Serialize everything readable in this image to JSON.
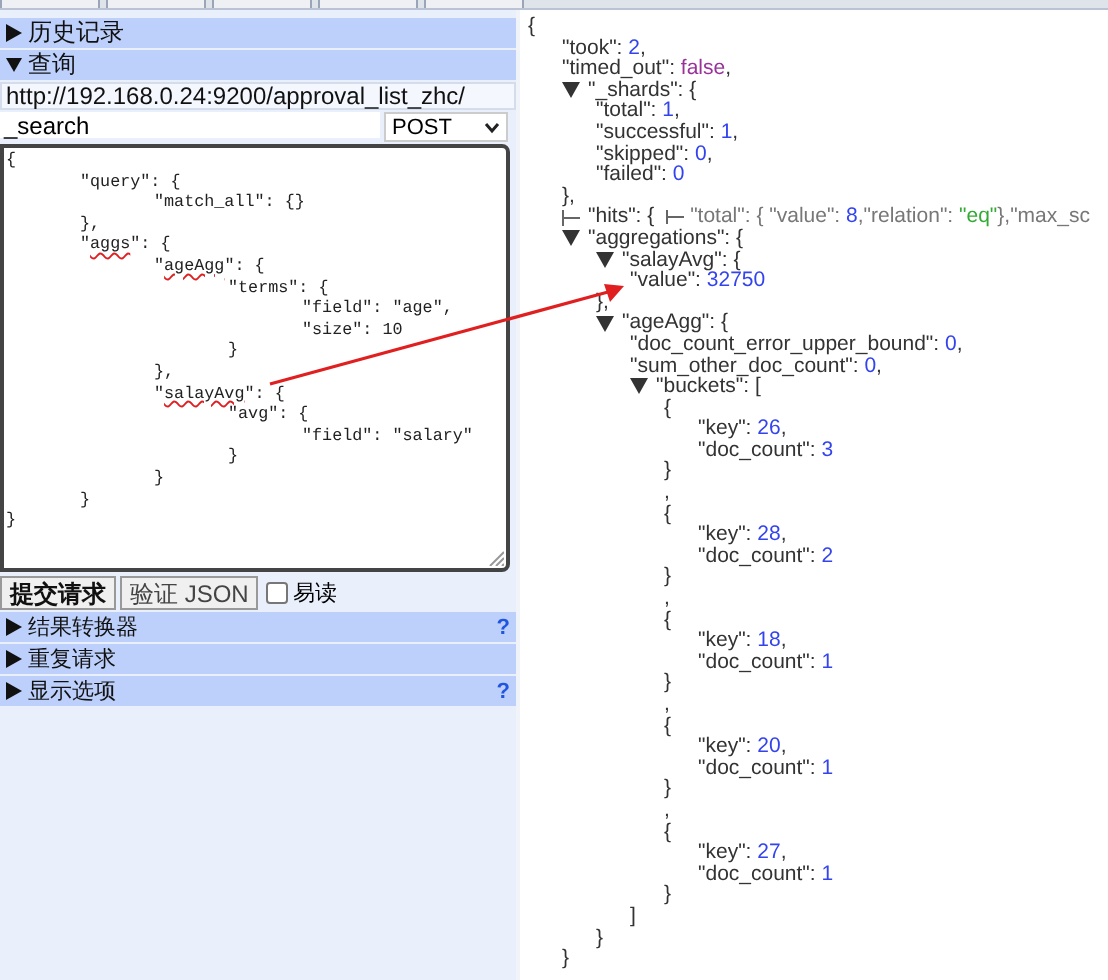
{
  "sections_top": [
    {
      "label": "历史记录",
      "expanded": false
    },
    {
      "label": "查询",
      "expanded": true
    }
  ],
  "query": {
    "url": "http://192.168.0.24:9200/approval_list_zhc/",
    "path": "_search",
    "method": "POST",
    "body": [
      {
        "segs": [
          {
            "t": "{"
          }
        ]
      },
      {
        "segs": [
          {
            "t": "\t\"query\": {"
          }
        ]
      },
      {
        "segs": [
          {
            "t": "\t\t\"match_all\": {}"
          }
        ]
      },
      {
        "segs": [
          {
            "t": "\t},"
          }
        ]
      },
      {
        "segs": [
          {
            "t": "\t\""
          },
          {
            "t": "aggs",
            "misspelled": true
          },
          {
            "t": "\": {"
          }
        ]
      },
      {
        "segs": [
          {
            "t": "\t\t\""
          },
          {
            "t": "ageAgg",
            "misspelled": true
          },
          {
            "t": "\": {"
          }
        ]
      },
      {
        "segs": [
          {
            "t": "\t\t\t\"terms\": {"
          }
        ]
      },
      {
        "segs": [
          {
            "t": "\t\t\t\t\"field\": \"age\","
          }
        ]
      },
      {
        "segs": [
          {
            "t": "\t\t\t\t\"size\": 10"
          }
        ]
      },
      {
        "segs": [
          {
            "t": "\t\t\t}"
          }
        ]
      },
      {
        "segs": [
          {
            "t": "\t\t},"
          }
        ]
      },
      {
        "segs": [
          {
            "t": "\t\t\""
          },
          {
            "t": "salayAvg",
            "misspelled": true
          },
          {
            "t": "\": {"
          }
        ]
      },
      {
        "segs": [
          {
            "t": "\t\t\t\"avg\": {"
          }
        ]
      },
      {
        "segs": [
          {
            "t": "\t\t\t\t\"field\": \"salary\""
          }
        ]
      },
      {
        "segs": [
          {
            "t": "\t\t\t}"
          }
        ]
      },
      {
        "segs": [
          {
            "t": "\t\t}"
          }
        ]
      },
      {
        "segs": [
          {
            "t": "\t}"
          }
        ]
      },
      {
        "segs": [
          {
            "t": "}"
          }
        ]
      }
    ]
  },
  "actions": {
    "submit": "提交请求",
    "validate": "验证 JSON",
    "pretty": {
      "label": "易读",
      "checked": false
    }
  },
  "sections_bottom": [
    {
      "label": "结果转换器",
      "expanded": false,
      "help": "?"
    },
    {
      "label": "重复请求",
      "expanded": false
    },
    {
      "label": "显示选项",
      "expanded": false,
      "help": "?"
    }
  ],
  "response": [
    {
      "segs": [
        {
          "text": "{",
          "kind": "punct"
        }
      ],
      "children": [
        {
          "segs": [
            {
              "text": "\"took\": ",
              "kind": "key"
            },
            {
              "text": "2",
              "kind": "number"
            },
            {
              "text": ",",
              "kind": "punct"
            }
          ]
        },
        {
          "segs": [
            {
              "text": "\"timed_out\": ",
              "kind": "key"
            },
            {
              "text": "false",
              "kind": "bool"
            },
            {
              "text": ",",
              "kind": "punct"
            }
          ]
        },
        {
          "expanded": true,
          "segs": [
            {
              "text": "\"_shards\": {",
              "kind": "key"
            }
          ],
          "children": [
            {
              "segs": [
                {
                  "text": "\"total\": ",
                  "kind": "key"
                },
                {
                  "text": "1",
                  "kind": "number"
                },
                {
                  "text": ",",
                  "kind": "punct"
                }
              ]
            },
            {
              "segs": [
                {
                  "text": "\"successful\": ",
                  "kind": "key"
                },
                {
                  "text": "1",
                  "kind": "number"
                },
                {
                  "text": ",",
                  "kind": "punct"
                }
              ]
            },
            {
              "segs": [
                {
                  "text": "\"skipped\": ",
                  "kind": "key"
                },
                {
                  "text": "0",
                  "kind": "number"
                },
                {
                  "text": ",",
                  "kind": "punct"
                }
              ]
            },
            {
              "segs": [
                {
                  "text": "\"failed\": ",
                  "kind": "key"
                },
                {
                  "text": "0",
                  "kind": "number"
                }
              ]
            }
          ]
        },
        {
          "segs": [
            {
              "text": "},",
              "kind": "punct"
            }
          ]
        },
        {
          "expanded": false,
          "segs": [
            {
              "text": "\"hits\": { ",
              "kind": "key"
            },
            {
              "kind": "fold"
            },
            {
              "text": "\"total\": { \"value\": ",
              "kind": "summary"
            },
            {
              "text": "8",
              "kind": "number"
            },
            {
              "text": ",\"relation\": ",
              "kind": "summary"
            },
            {
              "text": "\"eq\"",
              "kind": "string"
            },
            {
              "text": "},\"max_sc",
              "kind": "summary"
            }
          ]
        },
        {
          "expanded": true,
          "segs": [
            {
              "text": "\"aggregations\": {",
              "kind": "key"
            }
          ],
          "children": [
            {
              "expanded": true,
              "segs": [
                {
                  "text": "\"salayAvg\": {",
                  "kind": "key"
                }
              ],
              "children": [
                {
                  "segs": [
                    {
                      "text": "\"value\": ",
                      "kind": "key"
                    },
                    {
                      "text": "32750",
                      "kind": "number"
                    }
                  ]
                }
              ]
            },
            {
              "segs": [
                {
                  "text": "},",
                  "kind": "punct"
                }
              ]
            },
            {
              "expanded": true,
              "segs": [
                {
                  "text": "\"ageAgg\": {",
                  "kind": "key"
                }
              ],
              "children": [
                {
                  "segs": [
                    {
                      "text": "\"doc_count_error_upper_bound\": ",
                      "kind": "key"
                    },
                    {
                      "text": "0",
                      "kind": "number"
                    },
                    {
                      "text": ",",
                      "kind": "punct"
                    }
                  ]
                },
                {
                  "segs": [
                    {
                      "text": "\"sum_other_doc_count\": ",
                      "kind": "key"
                    },
                    {
                      "text": "0",
                      "kind": "number"
                    },
                    {
                      "text": ",",
                      "kind": "punct"
                    }
                  ]
                },
                {
                  "expanded": true,
                  "segs": [
                    {
                      "text": "\"buckets\": [",
                      "kind": "key"
                    }
                  ],
                  "children": [
                    {
                      "segs": [
                        {
                          "text": "{",
                          "kind": "punct"
                        }
                      ],
                      "children": [
                        {
                          "segs": [
                            {
                              "text": "\"key\": ",
                              "kind": "key"
                            },
                            {
                              "text": "26",
                              "kind": "number"
                            },
                            {
                              "text": ",",
                              "kind": "punct"
                            }
                          ]
                        },
                        {
                          "segs": [
                            {
                              "text": "\"doc_count\": ",
                              "kind": "key"
                            },
                            {
                              "text": "3",
                              "kind": "number"
                            }
                          ]
                        }
                      ]
                    },
                    {
                      "segs": [
                        {
                          "text": "}",
                          "kind": "punct"
                        }
                      ]
                    },
                    {
                      "segs": [
                        {
                          "text": ",",
                          "kind": "punct"
                        }
                      ]
                    },
                    {
                      "segs": [
                        {
                          "text": "{",
                          "kind": "punct"
                        }
                      ],
                      "children": [
                        {
                          "segs": [
                            {
                              "text": "\"key\": ",
                              "kind": "key"
                            },
                            {
                              "text": "28",
                              "kind": "number"
                            },
                            {
                              "text": ",",
                              "kind": "punct"
                            }
                          ]
                        },
                        {
                          "segs": [
                            {
                              "text": "\"doc_count\": ",
                              "kind": "key"
                            },
                            {
                              "text": "2",
                              "kind": "number"
                            }
                          ]
                        }
                      ]
                    },
                    {
                      "segs": [
                        {
                          "text": "}",
                          "kind": "punct"
                        }
                      ]
                    },
                    {
                      "segs": [
                        {
                          "text": ",",
                          "kind": "punct"
                        }
                      ]
                    },
                    {
                      "segs": [
                        {
                          "text": "{",
                          "kind": "punct"
                        }
                      ],
                      "children": [
                        {
                          "segs": [
                            {
                              "text": "\"key\": ",
                              "kind": "key"
                            },
                            {
                              "text": "18",
                              "kind": "number"
                            },
                            {
                              "text": ",",
                              "kind": "punct"
                            }
                          ]
                        },
                        {
                          "segs": [
                            {
                              "text": "\"doc_count\": ",
                              "kind": "key"
                            },
                            {
                              "text": "1",
                              "kind": "number"
                            }
                          ]
                        }
                      ]
                    },
                    {
                      "segs": [
                        {
                          "text": "}",
                          "kind": "punct"
                        }
                      ]
                    },
                    {
                      "segs": [
                        {
                          "text": ",",
                          "kind": "punct"
                        }
                      ]
                    },
                    {
                      "segs": [
                        {
                          "text": "{",
                          "kind": "punct"
                        }
                      ],
                      "children": [
                        {
                          "segs": [
                            {
                              "text": "\"key\": ",
                              "kind": "key"
                            },
                            {
                              "text": "20",
                              "kind": "number"
                            },
                            {
                              "text": ",",
                              "kind": "punct"
                            }
                          ]
                        },
                        {
                          "segs": [
                            {
                              "text": "\"doc_count\": ",
                              "kind": "key"
                            },
                            {
                              "text": "1",
                              "kind": "number"
                            }
                          ]
                        }
                      ]
                    },
                    {
                      "segs": [
                        {
                          "text": "}",
                          "kind": "punct"
                        }
                      ]
                    },
                    {
                      "segs": [
                        {
                          "text": ",",
                          "kind": "punct"
                        }
                      ]
                    },
                    {
                      "segs": [
                        {
                          "text": "{",
                          "kind": "punct"
                        }
                      ],
                      "children": [
                        {
                          "segs": [
                            {
                              "text": "\"key\": ",
                              "kind": "key"
                            },
                            {
                              "text": "27",
                              "kind": "number"
                            },
                            {
                              "text": ",",
                              "kind": "punct"
                            }
                          ]
                        },
                        {
                          "segs": [
                            {
                              "text": "\"doc_count\": ",
                              "kind": "key"
                            },
                            {
                              "text": "1",
                              "kind": "number"
                            }
                          ]
                        }
                      ]
                    },
                    {
                      "segs": [
                        {
                          "text": "}",
                          "kind": "punct"
                        }
                      ]
                    }
                  ]
                },
                {
                  "segs": [
                    {
                      "text": "]",
                      "kind": "punct"
                    }
                  ]
                }
              ]
            },
            {
              "segs": [
                {
                  "text": "}",
                  "kind": "punct"
                }
              ]
            }
          ]
        },
        {
          "segs": [
            {
              "text": "}",
              "kind": "punct"
            }
          ]
        }
      ]
    }
  ]
}
